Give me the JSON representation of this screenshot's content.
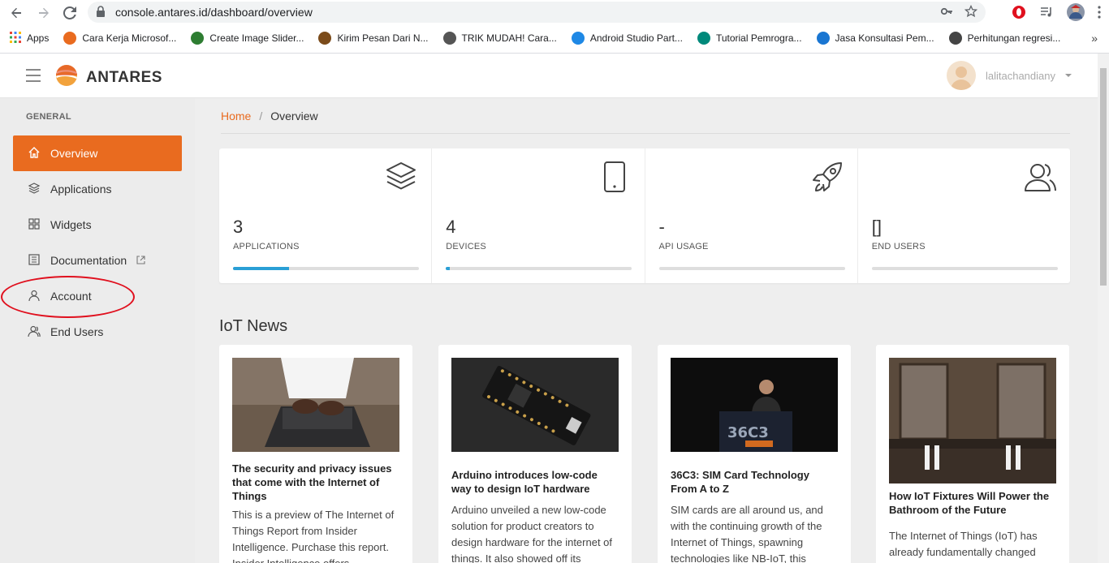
{
  "browser": {
    "url": "console.antares.id/dashboard/overview",
    "bookmarks": [
      {
        "label": "Apps",
        "color": "#4285f4"
      },
      {
        "label": "Cara Kerja Microsof...",
        "color": "#e96b1f"
      },
      {
        "label": "Create Image Slider...",
        "color": "#2e7d32"
      },
      {
        "label": "Kirim Pesan Dari N...",
        "color": "#7b4b1a"
      },
      {
        "label": "TRIK MUDAH! Cara...",
        "color": "#555555"
      },
      {
        "label": "Android Studio Part...",
        "color": "#1e88e5"
      },
      {
        "label": "Tutorial Pemrogra...",
        "color": "#00897b"
      },
      {
        "label": "Jasa Konsultasi Pem...",
        "color": "#1976d2"
      },
      {
        "label": "Perhitungan regresi...",
        "color": "#444444"
      }
    ],
    "more": "»"
  },
  "header": {
    "brand": "ANTARES",
    "username": "lalitachandiany"
  },
  "sidebar": {
    "section": "GENERAL",
    "items": [
      {
        "label": "Overview"
      },
      {
        "label": "Applications"
      },
      {
        "label": "Widgets"
      },
      {
        "label": "Documentation"
      },
      {
        "label": "Account"
      },
      {
        "label": "End Users"
      }
    ]
  },
  "breadcrumb": {
    "home": "Home",
    "separator": "/",
    "current": "Overview"
  },
  "stats": [
    {
      "value": "3",
      "label": "APPLICATIONS",
      "progress": 0.3
    },
    {
      "value": "4",
      "label": "DEVICES",
      "progress": 0.02
    },
    {
      "value": "-",
      "label": "API USAGE",
      "progress": 0
    },
    {
      "value": "[]",
      "label": "END USERS",
      "progress": 0
    }
  ],
  "news": {
    "title": "IoT News",
    "items": [
      {
        "headline": "The security and privacy issues that come with the Internet of Things",
        "body": "This is a preview of The Internet of Things Report from Insider Intelligence. Purchase this report. Insider Intelligence offers"
      },
      {
        "headline": "Arduino introduces low-code way to design IoT hardware",
        "body": "Arduino unveiled a new low-code solution for product creators to design hardware for the internet of things. It also showed off its"
      },
      {
        "headline": "36C3: SIM Card Technology From A to Z",
        "body": "SIM cards are all around us, and with the continuing growth of the Internet of Things, spawning technologies like NB-IoT, this"
      },
      {
        "headline": "How IoT Fixtures Will Power the Bathroom of the Future",
        "body": "The Internet of Things (IoT) has already fundamentally changed"
      }
    ]
  },
  "colors": {
    "accent": "#e96b1f",
    "progress": "#2a9fd6",
    "annotation": "#e0101e"
  }
}
